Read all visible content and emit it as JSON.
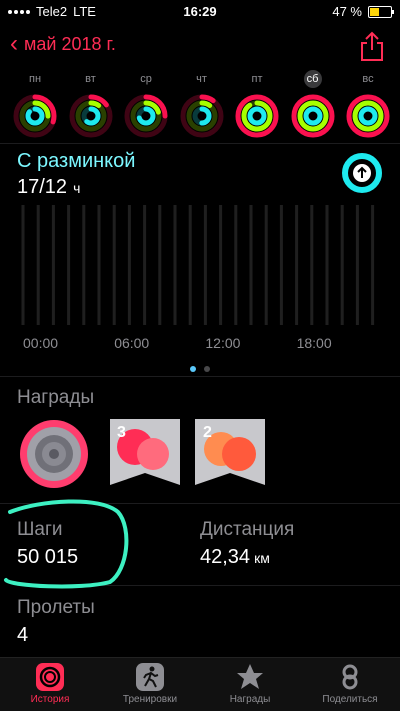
{
  "status": {
    "carrier": "Tele2",
    "network": "LTE",
    "time": "16:29",
    "battery": "47 %",
    "battery_fraction": 0.47
  },
  "nav": {
    "back_label": "май 2018 г."
  },
  "week": [
    {
      "label": "пн",
      "selected": false
    },
    {
      "label": "вт",
      "selected": false
    },
    {
      "label": "ср",
      "selected": false
    },
    {
      "label": "чт",
      "selected": false
    },
    {
      "label": "пт",
      "selected": false
    },
    {
      "label": "сб",
      "selected": true
    },
    {
      "label": "вс",
      "selected": false
    }
  ],
  "stand": {
    "title": "С разминкой",
    "value": "17/12",
    "unit": "ч"
  },
  "graph": {
    "x_labels": [
      "00:00",
      "06:00",
      "12:00",
      "18:00"
    ]
  },
  "awards": {
    "title": "Награды",
    "items": [
      "medal-award",
      "badge-30-award",
      "badge-20-award"
    ]
  },
  "stats": {
    "steps_label": "Шаги",
    "steps_value": "50 015",
    "distance_label": "Дистанция",
    "distance_value": "42,34",
    "distance_unit": "км",
    "flights_label": "Пролеты",
    "flights_value": "4"
  },
  "tabs": [
    {
      "label": "История",
      "icon": "history-icon",
      "active": true
    },
    {
      "label": "Тренировки",
      "icon": "workouts-icon",
      "active": false
    },
    {
      "label": "Награды",
      "icon": "awards-icon",
      "active": false
    },
    {
      "label": "Поделиться",
      "icon": "sharing-icon",
      "active": false
    }
  ],
  "colors": {
    "accent": "#ff2d55",
    "move": "#fa114f",
    "exercise": "#a6ff00",
    "stand": "#1eeaef"
  }
}
